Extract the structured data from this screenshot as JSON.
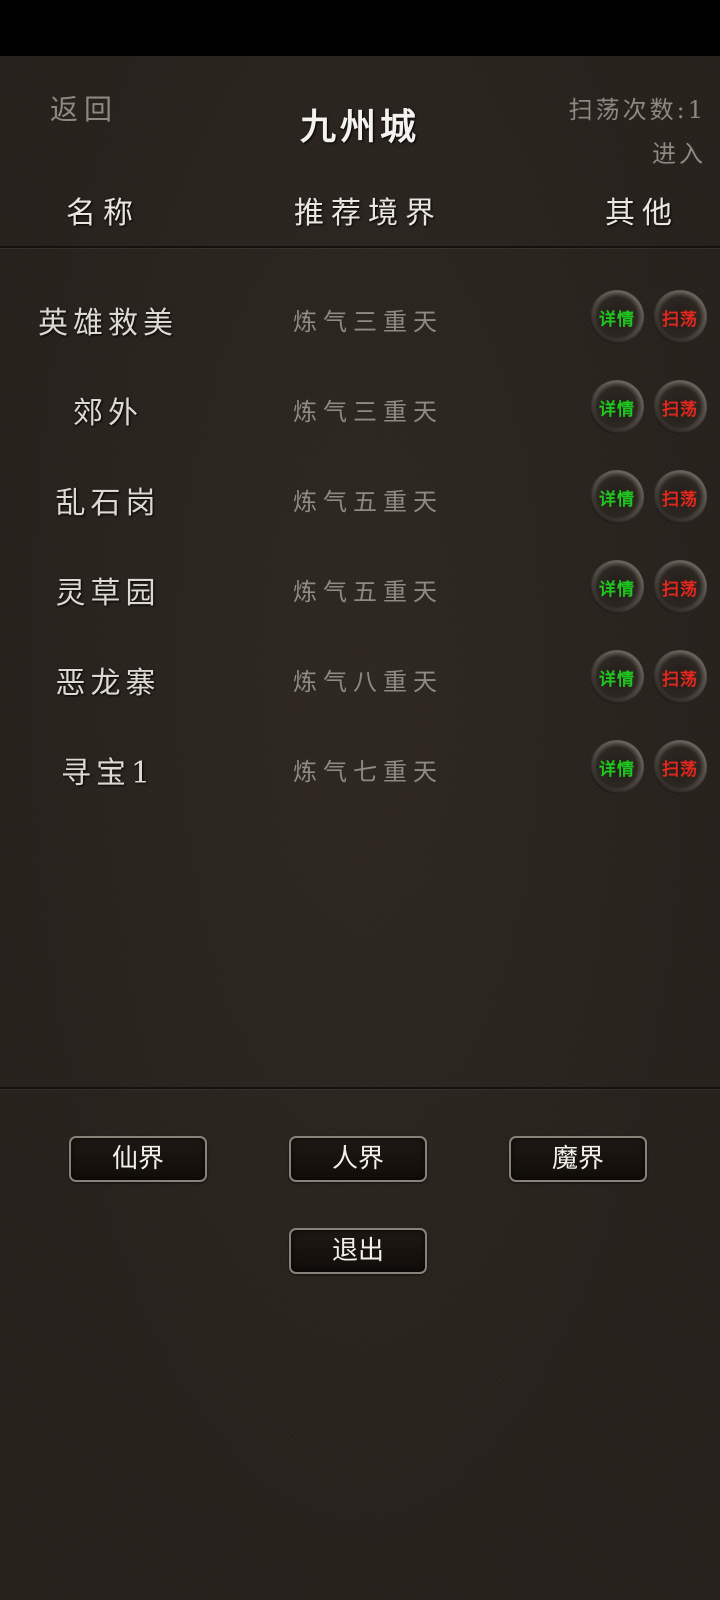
{
  "header": {
    "back_label": "返回",
    "title": "九州城",
    "sweep_count": "扫荡次数:1",
    "enter_label": "进入"
  },
  "columns": {
    "name": "名称",
    "realm": "推荐境界",
    "other": "其他"
  },
  "levels": [
    {
      "name": "英雄救美",
      "realm": "炼气三重天",
      "detail": "详情",
      "sweep": "扫荡"
    },
    {
      "name": "郊外",
      "realm": "炼气三重天",
      "detail": "详情",
      "sweep": "扫荡"
    },
    {
      "name": "乱石岗",
      "realm": "炼气五重天",
      "detail": "详情",
      "sweep": "扫荡"
    },
    {
      "name": "灵草园",
      "realm": "炼气五重天",
      "detail": "详情",
      "sweep": "扫荡"
    },
    {
      "name": "恶龙寨",
      "realm": "炼气八重天",
      "detail": "详情",
      "sweep": "扫荡"
    },
    {
      "name": "寻宝1",
      "realm": "炼气七重天",
      "detail": "详情",
      "sweep": "扫荡"
    }
  ],
  "footer": {
    "xianjie": "仙界",
    "renjie": "人界",
    "mojie": "魔界",
    "exit": "退出"
  },
  "colors": {
    "background": "#28221d",
    "detail_text": "#1fc81f",
    "sweep_text": "#e2281e"
  }
}
